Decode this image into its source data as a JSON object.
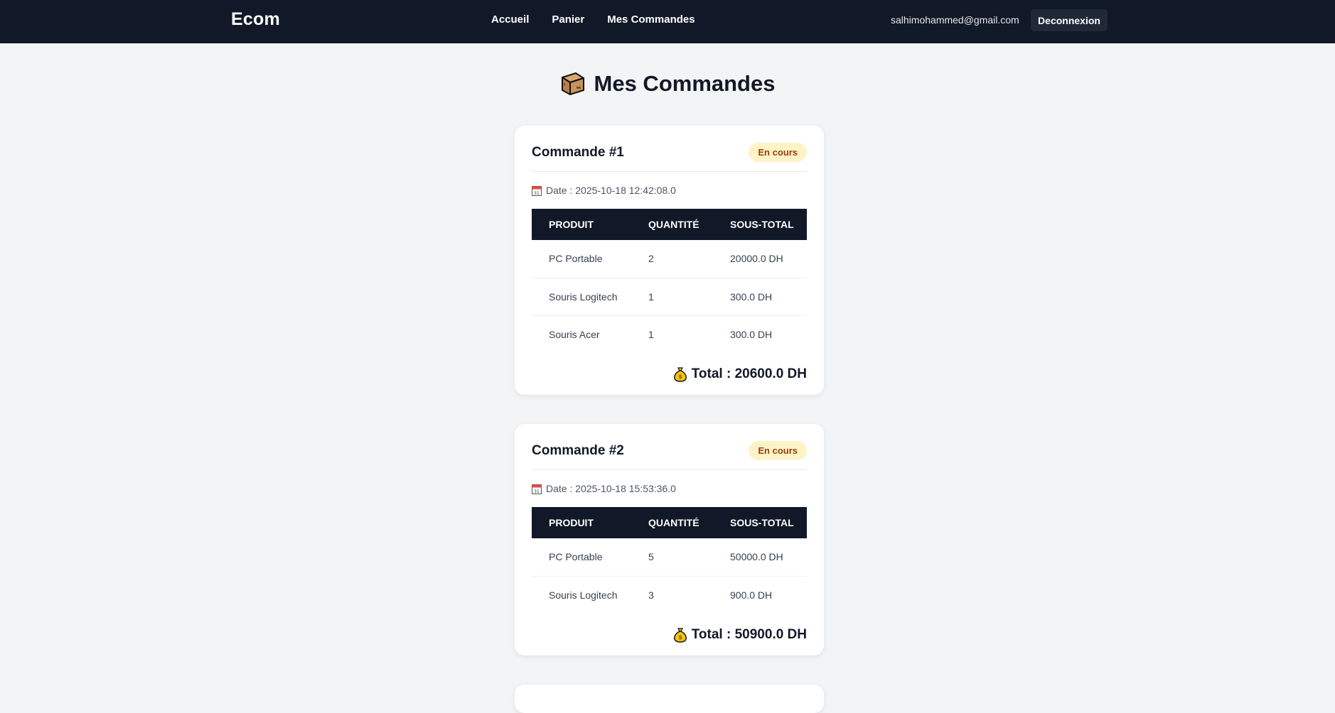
{
  "navbar": {
    "brand": "Ecom",
    "links": [
      {
        "label": "Accueil"
      },
      {
        "label": "Panier"
      },
      {
        "label": "Mes Commandes"
      }
    ],
    "email": "salhimohammed@gmail.com",
    "logout_label": "Deconnexion",
    "background": "#111827"
  },
  "page": {
    "title": "Mes Commandes",
    "title_icon": "package-icon"
  },
  "orders": [
    {
      "title": "Commande #1",
      "status": "En cours",
      "date": "Date : 2025-10-18 12:42:08.0",
      "columns": [
        "PRODUIT",
        "QUANTITÉ",
        "SOUS-TOTAL"
      ],
      "items": [
        {
          "product": "PC Portable",
          "quantity": "2",
          "subtotal": "20000.0 DH"
        },
        {
          "product": "Souris Logitech",
          "quantity": "1",
          "subtotal": "300.0 DH"
        },
        {
          "product": "Souris Acer",
          "quantity": "1",
          "subtotal": "300.0 DH"
        }
      ],
      "total": "Total : 20600.0 DH"
    },
    {
      "title": "Commande #2",
      "status": "En cours",
      "date": "Date : 2025-10-18 15:53:36.0",
      "columns": [
        "PRODUIT",
        "QUANTITÉ",
        "SOUS-TOTAL"
      ],
      "items": [
        {
          "product": "PC Portable",
          "quantity": "5",
          "subtotal": "50000.0 DH"
        },
        {
          "product": "Souris Logitech",
          "quantity": "3",
          "subtotal": "900.0 DH"
        }
      ],
      "total": "Total : 50900.0 DH"
    }
  ],
  "colors": {
    "status_bg": "#fef3c7",
    "status_text": "#92400e",
    "table_header_bg": "#111827",
    "page_bg": "#f3f4f6"
  }
}
